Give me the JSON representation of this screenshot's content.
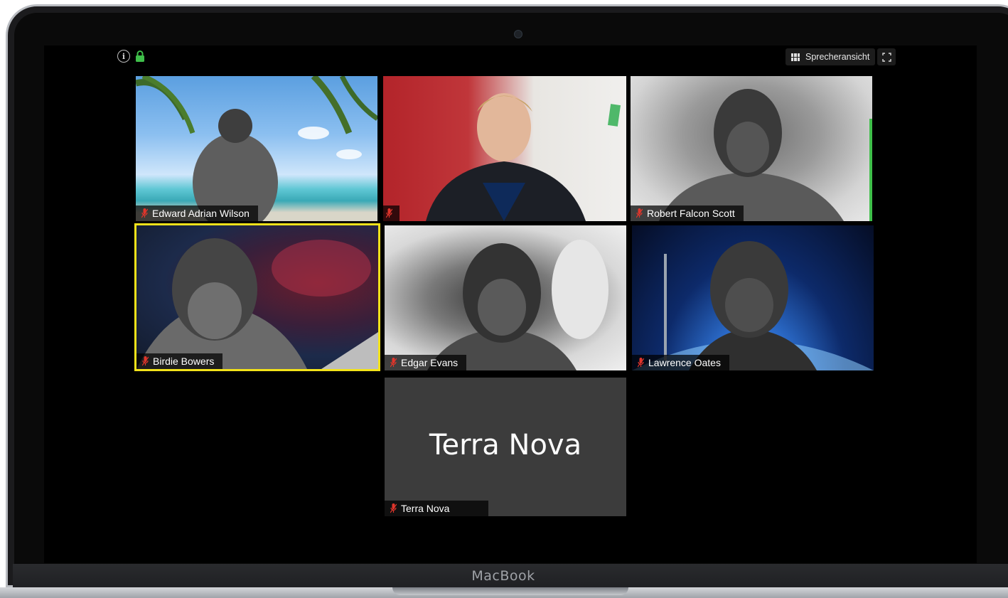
{
  "device": {
    "brand": "MacBook"
  },
  "toolbar": {
    "speaker_view_label": "Sprecheransicht"
  },
  "icons": {
    "info": "info-icon",
    "lock": "lock-icon",
    "gallery": "grid-icon",
    "fullscreen": "fullscreen-icon",
    "mic_muted": "microphone-muted-icon"
  },
  "colors": {
    "active_speaker_border": "#f2e21a",
    "lock": "#3fbf4a",
    "mic_muted": "#e0352b",
    "placeholder_tile": "#3c3c3c"
  },
  "participants": [
    {
      "name": "Edward Adrian Wilson",
      "muted": true
    },
    {
      "name": "",
      "muted": true
    },
    {
      "name": "Robert Falcon Scott",
      "muted": true
    },
    {
      "name": "Birdie Bowers",
      "muted": true,
      "active_speaker": true
    },
    {
      "name": "Edgar Evans",
      "muted": true
    },
    {
      "name": "Lawrence Oates",
      "muted": true
    },
    {
      "name": "Terra Nova",
      "muted": true,
      "video_off": true,
      "display_text": "Terra Nova"
    }
  ]
}
